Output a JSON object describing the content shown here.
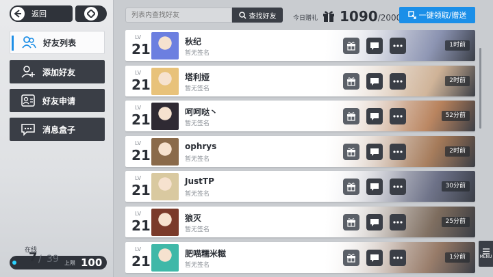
{
  "header": {
    "back_label": "返回",
    "search_placeholder": "列表内查找好友",
    "search_button": "查找好友",
    "gift_caption": "今日赠礼",
    "gift_count": "1090",
    "gift_max": "2000",
    "claim_button": "一键领取/赠送"
  },
  "sidebar": {
    "items": [
      {
        "label": "好友列表",
        "icon": "friends-icon",
        "active": true
      },
      {
        "label": "添加好友",
        "icon": "add-friend-icon",
        "active": false
      },
      {
        "label": "好友申请",
        "icon": "friend-request-icon",
        "active": false
      },
      {
        "label": "消息盒子",
        "icon": "message-box-icon",
        "active": false
      }
    ],
    "online_caption": "在线",
    "online_current": "7",
    "online_total": "39",
    "limit_caption": "上限",
    "limit_value": "100"
  },
  "friends": [
    {
      "lv_caption": "LV",
      "level": "21",
      "name": "秋纪",
      "signature": "暂无签名",
      "time": "1时前",
      "avatar_color": "#6c7fe0"
    },
    {
      "lv_caption": "LV",
      "level": "21",
      "name": "塔利娅",
      "signature": "暂无签名",
      "time": "2时前",
      "avatar_color": "#e8c27a"
    },
    {
      "lv_caption": "LV",
      "level": "21",
      "name": "呵呵哒丶",
      "signature": "暂无签名",
      "time": "52分前",
      "avatar_color": "#2f2a33"
    },
    {
      "lv_caption": "LV",
      "level": "21",
      "name": "ophrys",
      "signature": "暂无签名",
      "time": "2时前",
      "avatar_color": "#8a6a4a"
    },
    {
      "lv_caption": "LV",
      "level": "21",
      "name": "JustTP",
      "signature": "暂无签名",
      "time": "30分前",
      "avatar_color": "#d9c9a0"
    },
    {
      "lv_caption": "LV",
      "level": "21",
      "name": "狼灭",
      "signature": "暂无签名",
      "time": "25分前",
      "avatar_color": "#7a3a2a"
    },
    {
      "lv_caption": "LV",
      "level": "21",
      "name": "肥喵糯米糍",
      "signature": "暂无签名",
      "time": "1分前",
      "avatar_color": "#3fb8a8"
    }
  ],
  "menu_label": "MENU",
  "colors": {
    "accent": "#1b8fe8",
    "dark": "#3a3e46"
  }
}
